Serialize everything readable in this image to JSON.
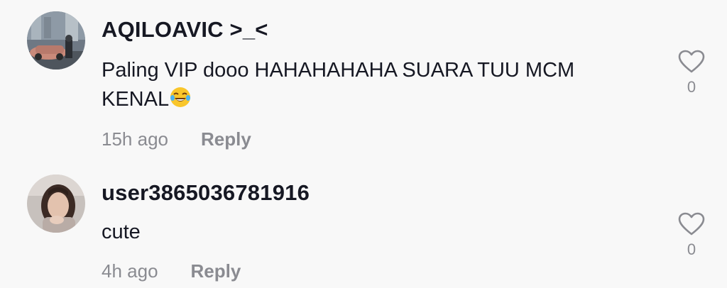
{
  "comments": [
    {
      "username": "AQILOAVIC >_<",
      "text": "Paling VIP dooo HAHAHAHAHA SUARA TUU MCM KENAL",
      "emoji": "face-with-tears-of-joy",
      "time": "15h ago",
      "reply_label": "Reply",
      "like_count": "0"
    },
    {
      "username": "user3865036781916",
      "text": "cute",
      "time": "4h ago",
      "reply_label": "Reply",
      "like_count": "0"
    }
  ],
  "colors": {
    "background": "#f8f8f8",
    "primary_text": "#161823",
    "secondary_text": "#8a8b91"
  }
}
